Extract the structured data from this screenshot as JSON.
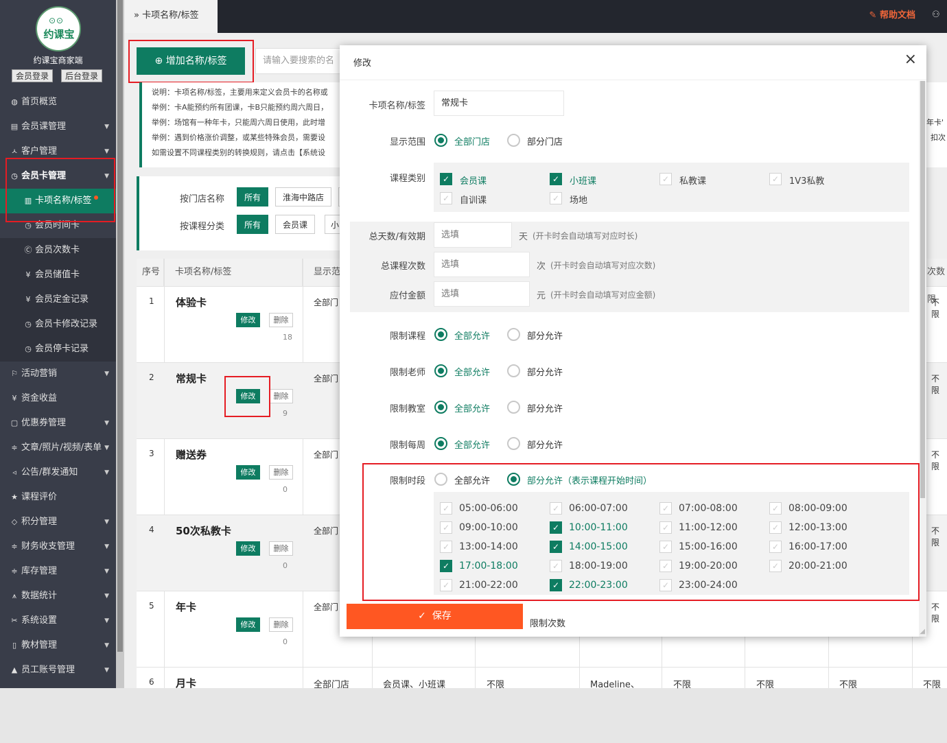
{
  "sidebar": {
    "logo_text": "约课宝",
    "brand": "约课宝商家端",
    "btn_member_login": "会员登录",
    "btn_admin_login": "后台登录",
    "items": [
      {
        "label": "首页概览",
        "icon": "globe-icon"
      },
      {
        "label": "会员课管理",
        "icon": "doc-icon"
      },
      {
        "label": "客户管理",
        "icon": "user-icon"
      },
      {
        "label": "会员卡管理",
        "icon": "clock-icon"
      },
      {
        "label": "卡项名称/标签",
        "icon": "list-icon"
      },
      {
        "label": "会员时间卡",
        "icon": "clock-icon"
      },
      {
        "label": "会员次数卡",
        "icon": "c-icon"
      },
      {
        "label": "会员储值卡",
        "icon": "yen-icon"
      },
      {
        "label": "会员定金记录",
        "icon": "yen-icon"
      },
      {
        "label": "会员卡修改记录",
        "icon": "clock-icon"
      },
      {
        "label": "会员停卡记录",
        "icon": "clock-icon"
      },
      {
        "label": "活动营销",
        "icon": "flag-icon"
      },
      {
        "label": "资金收益",
        "icon": "yen-icon"
      },
      {
        "label": "优惠券管理",
        "icon": "ticket-icon"
      },
      {
        "label": "文章/照片/视频/表单",
        "icon": "sliders-icon"
      },
      {
        "label": "公告/群发通知",
        "icon": "speaker-icon"
      },
      {
        "label": "课程评价",
        "icon": "star-icon"
      },
      {
        "label": "积分管理",
        "icon": "diamond-icon"
      },
      {
        "label": "财务收支管理",
        "icon": "sliders-icon"
      },
      {
        "label": "库存管理",
        "icon": "sliders-icon"
      },
      {
        "label": "数据统计",
        "icon": "chart-icon"
      },
      {
        "label": "系统设置",
        "icon": "tools-icon"
      },
      {
        "label": "教材管理",
        "icon": "book-icon"
      },
      {
        "label": "员工账号管理",
        "icon": "person-icon"
      }
    ]
  },
  "topbar": {
    "tab_label": "卡项名称/标签",
    "help_label": "帮助文档"
  },
  "toolbar": {
    "add_label": "增加名称/标签",
    "search_placeholder": "请输入要搜索的名"
  },
  "note": {
    "lines": [
      "说明：卡项名称/标签，主要用来定义会员卡的名称或",
      "举例：卡A能预约所有团课，卡B只能预约周六周日，",
      "举例：场馆有一种年卡，只能周六周日使用，此时增",
      "举例：遇到价格涨价调整，或某些特殊会员，需要设",
      "如需设置不同课程类别的转换规则，请点击【系统设"
    ],
    "right_lines": [
      "年卡'",
      "扣次"
    ]
  },
  "filters": {
    "store_label": "按门店名称",
    "store_all": "所有",
    "store_opt": "淮海中路店",
    "course_label": "按课程分类",
    "course_all": "所有",
    "course_opt1": "会员课",
    "course_opt2": "小"
  },
  "table": {
    "headers": [
      "序号",
      "卡项名称/标签",
      "显示范",
      "次数限"
    ],
    "rows": [
      {
        "no": "1",
        "name": "体验卡",
        "edit": "修改",
        "del": "删除",
        "count": "18",
        "scope": "全部门",
        "right": "不限"
      },
      {
        "no": "2",
        "name": "常规卡",
        "edit": "修改",
        "del": "删除",
        "count": "9",
        "scope": "全部门",
        "right": "不限"
      },
      {
        "no": "3",
        "name": "赠送券",
        "edit": "修改",
        "del": "删除",
        "count": "0",
        "scope": "全部门",
        "right": "不限"
      },
      {
        "no": "4",
        "name": "50次私教卡",
        "edit": "修改",
        "del": "删除",
        "count": "0",
        "scope": "全部门",
        "right": "不限"
      },
      {
        "no": "5",
        "name": "年卡",
        "edit": "修改",
        "del": "删除",
        "count": "0",
        "scope": "全部门",
        "right": "不限"
      }
    ],
    "row6": {
      "no": "6",
      "name": "月卡",
      "scope": "全部门店",
      "courses": "会员课、小班课",
      "c1": "不限",
      "teacher": "Madeline、",
      "c2": "不限",
      "c3": "不限",
      "c4": "不限",
      "c5": "不限"
    }
  },
  "modal": {
    "title": "修改",
    "name_label": "卡项名称/标签",
    "name_value": "常规卡",
    "scope_label": "显示范围",
    "scope_all": "全部门店",
    "scope_part": "部分门店",
    "course_label": "课程类别",
    "courses": [
      {
        "label": "会员课",
        "checked": true
      },
      {
        "label": "小班课",
        "checked": true
      },
      {
        "label": "私教课",
        "checked": false
      },
      {
        "label": "1V3私教",
        "checked": false
      },
      {
        "label": "自训课",
        "checked": false
      },
      {
        "label": "场地",
        "checked": false
      }
    ],
    "days_label": "总天数/有效期",
    "days_placeholder": "选填",
    "days_unit": "天",
    "days_hint": "(开卡时会自动填写对应时长)",
    "times_label": "总课程次数",
    "times_placeholder": "选填",
    "times_unit": "次",
    "times_hint": "(开卡时会自动填写对应次数)",
    "amount_label": "应付金额",
    "amount_placeholder": "选填",
    "amount_unit": "元",
    "amount_hint": "(开卡时会自动填写对应金额)",
    "limits": [
      {
        "label": "限制课程",
        "all": "全部允许",
        "part": "部分允许"
      },
      {
        "label": "限制老师",
        "all": "全部允许",
        "part": "部分允许"
      },
      {
        "label": "限制教室",
        "all": "全部允许",
        "part": "部分允许"
      },
      {
        "label": "限制每周",
        "all": "全部允许",
        "part": "部分允许"
      }
    ],
    "period_label": "限制时段",
    "period_all": "全部允许",
    "period_part": "部分允许（表示课程开始时间）",
    "slots": [
      {
        "label": "05:00-06:00",
        "checked": false
      },
      {
        "label": "06:00-07:00",
        "checked": false
      },
      {
        "label": "07:00-08:00",
        "checked": false
      },
      {
        "label": "08:00-09:00",
        "checked": false
      },
      {
        "label": "09:00-10:00",
        "checked": false
      },
      {
        "label": "10:00-11:00",
        "checked": true
      },
      {
        "label": "11:00-12:00",
        "checked": false
      },
      {
        "label": "12:00-13:00",
        "checked": false
      },
      {
        "label": "13:00-14:00",
        "checked": false
      },
      {
        "label": "14:00-15:00",
        "checked": true
      },
      {
        "label": "15:00-16:00",
        "checked": false
      },
      {
        "label": "16:00-17:00",
        "checked": false
      },
      {
        "label": "17:00-18:00",
        "checked": true
      },
      {
        "label": "18:00-19:00",
        "checked": false
      },
      {
        "label": "19:00-20:00",
        "checked": false
      },
      {
        "label": "20:00-21:00",
        "checked": false
      },
      {
        "label": "21:00-22:00",
        "checked": false
      },
      {
        "label": "22:00-23:00",
        "checked": true
      },
      {
        "label": "23:00-24:00",
        "checked": false
      }
    ],
    "save_label": "保存",
    "limit_count_label": "限制次数"
  },
  "colors": {
    "primary": "#0e7c61",
    "save": "#ff5722",
    "highlight": "#e51c23",
    "help": "#f0663a"
  }
}
